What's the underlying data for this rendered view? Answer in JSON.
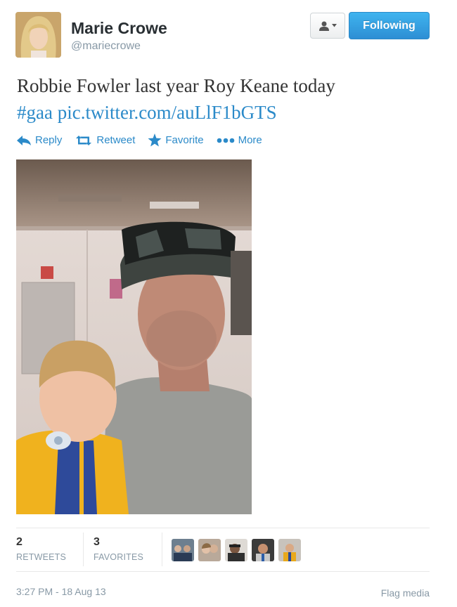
{
  "user": {
    "name": "Marie Crowe",
    "handle": "@mariecrowe"
  },
  "header": {
    "follow_label": "Following",
    "user_menu_icon": "user-icon"
  },
  "tweet": {
    "text_main": "Robbie Fowler last year Roy Keane today",
    "hashtag": "#gaa",
    "link": "pic.twitter.com/auLlF1bGTS"
  },
  "actions": [
    {
      "label": "Reply",
      "icon": "reply-icon"
    },
    {
      "label": "Retweet",
      "icon": "retweet-icon"
    },
    {
      "label": "Favorite",
      "icon": "star-icon"
    },
    {
      "label": "More",
      "icon": "more-icon"
    }
  ],
  "stats": {
    "retweets_count": "2",
    "retweets_label": "RETWEETS",
    "favorites_count": "3",
    "favorites_label": "FAVORITES"
  },
  "footer": {
    "timestamp": "3:27 PM - 18 Aug 13",
    "flag_label": "Flag media"
  },
  "colors": {
    "link": "#2b8ac9",
    "follow_button": "#2d8ed4",
    "muted": "#8899a6"
  }
}
